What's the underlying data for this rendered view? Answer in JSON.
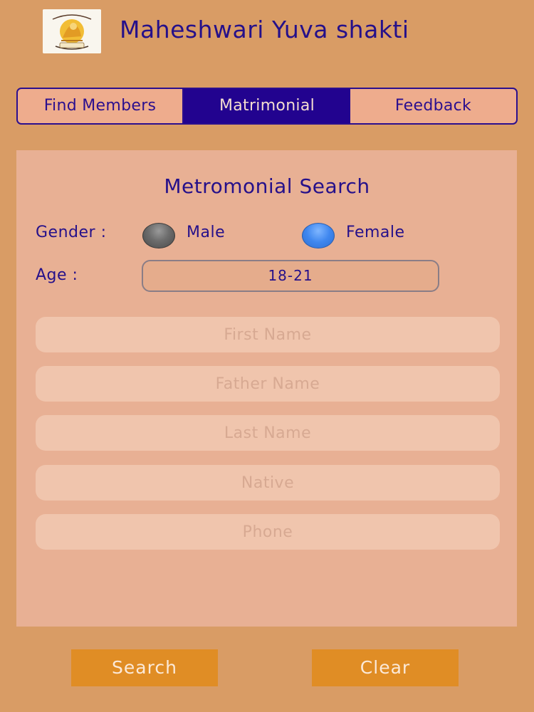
{
  "header": {
    "logo_icon": "emblem-logo-icon",
    "title": "Maheshwari Yuva shakti"
  },
  "tabs": [
    {
      "label": "Find Members",
      "active": false
    },
    {
      "label": "Matrimonial",
      "active": true
    },
    {
      "label": "Feedback",
      "active": false
    }
  ],
  "search": {
    "title": "Metromonial Search",
    "gender_label": "Gender :",
    "gender_options": [
      {
        "label": "Male",
        "selected": false
      },
      {
        "label": "Female",
        "selected": true
      }
    ],
    "age_label": "Age :",
    "age_value": "18-21",
    "fields": [
      {
        "placeholder": "First Name",
        "value": ""
      },
      {
        "placeholder": "Father Name",
        "value": ""
      },
      {
        "placeholder": "Last Name",
        "value": ""
      },
      {
        "placeholder": "Native",
        "value": ""
      },
      {
        "placeholder": "Phone",
        "value": ""
      }
    ]
  },
  "actions": {
    "search_label": "Search",
    "clear_label": "Clear"
  },
  "colors": {
    "background": "#d99c65",
    "panel": "#e8b094",
    "accent": "#22038f",
    "button": "#e08d25",
    "radio_selected": "#3f87ef"
  }
}
